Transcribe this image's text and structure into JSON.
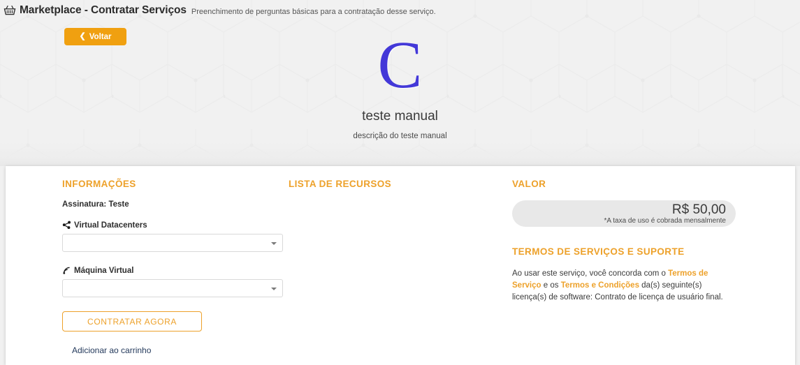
{
  "header": {
    "icon": "shopping-basket-icon",
    "title": "Marketplace - Contratar Serviços",
    "subtitle": "Preenchimento de perguntas básicas para a contratação desse serviço."
  },
  "hero": {
    "back_button": {
      "label": "Voltar",
      "icon": "chevron-left-icon",
      "color": "#f0a010"
    },
    "logo_letter": "C",
    "logo_color": "#4338d8",
    "service_name": "teste manual",
    "service_description": "descrição do teste manual",
    "background": "#f1f1f1",
    "pattern": "isometric-cube-outline-pattern"
  },
  "theme": {
    "accent": "#eda12a",
    "card_bg": "#ffffff",
    "price_box_bg": "#e8e8e8",
    "link_dark": "#23395b"
  },
  "info_column": {
    "title": "INFORMAÇÕES",
    "subscription_label": "Assinatura: Teste",
    "fields": [
      {
        "icon": "cube-share-icon",
        "label": "Virtual Datacenters",
        "value": "",
        "placeholder": "",
        "options": []
      },
      {
        "icon": "rss-signal-icon",
        "label": "Máquina Virtual",
        "value": "",
        "placeholder": "",
        "options": []
      }
    ],
    "cta_label": "CONTRATAR AGORA",
    "cart_link_label": "Adicionar ao carrinho"
  },
  "features_column": {
    "title": "LISTA DE RECURSOS",
    "items": []
  },
  "value_column": {
    "title": "VALOR",
    "price": "R$ 50,00",
    "price_note": "*A taxa de uso é cobrada mensalmente",
    "terms_title": "TERMOS DE SERVIÇOS E SUPORTE",
    "terms_part1": "Ao usar este serviço, você concorda com o ",
    "terms_link1": "Termos de Serviço",
    "terms_part2": " e os ",
    "terms_link2": "Termos e Condições",
    "terms_part3": " da(s) seguinte(s) licença(s) de software: Contrato de licença de usuário final."
  }
}
